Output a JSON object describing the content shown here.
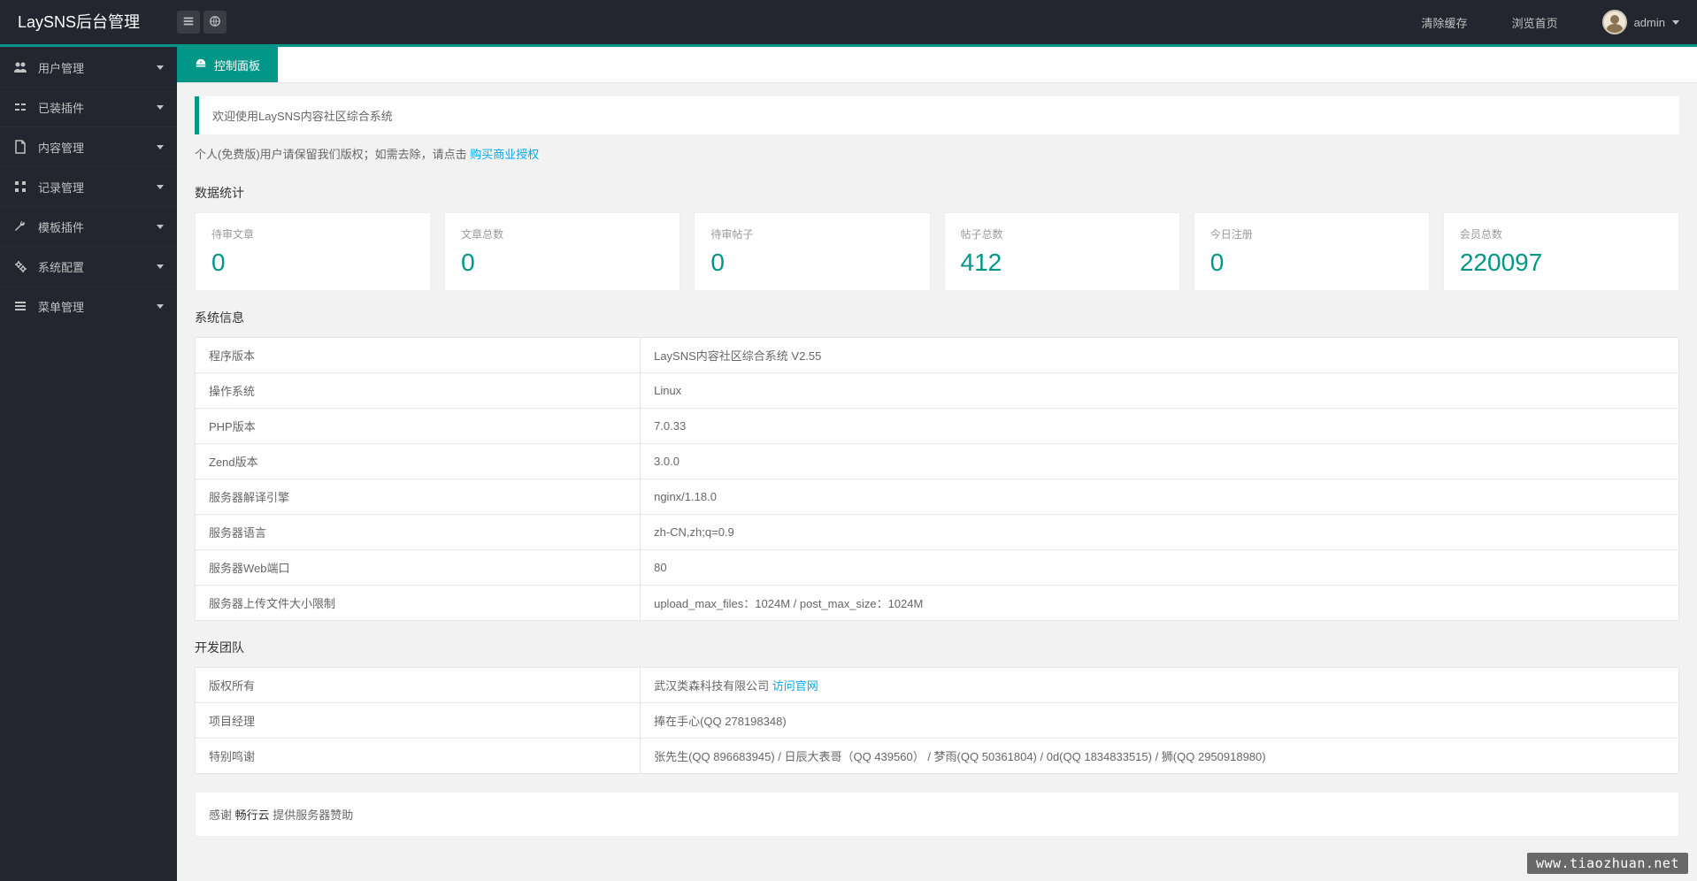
{
  "header": {
    "logo": "LaySNS后台管理",
    "clear_cache": "清除缓存",
    "browse_home": "浏览首页",
    "user_name": "admin"
  },
  "sidebar": {
    "items": [
      {
        "label": "用户管理",
        "icon": "users"
      },
      {
        "label": "已装插件",
        "icon": "plugin"
      },
      {
        "label": "内容管理",
        "icon": "file"
      },
      {
        "label": "记录管理",
        "icon": "grid"
      },
      {
        "label": "模板插件",
        "icon": "wrench"
      },
      {
        "label": "系统配置",
        "icon": "cogs"
      },
      {
        "label": "菜单管理",
        "icon": "menu"
      }
    ]
  },
  "tabs": {
    "dashboard": "控制面板"
  },
  "welcome": {
    "text": "欢迎使用LaySNS内容社区综合系统",
    "license_prefix": "个人(免费版)用户请保留我们版权；如需去除，请点击 ",
    "license_link": "购买商业授权"
  },
  "sections": {
    "stats_title": "数据统计",
    "sysinfo_title": "系统信息",
    "team_title": "开发团队"
  },
  "stats": [
    {
      "label": "待审文章",
      "value": "0"
    },
    {
      "label": "文章总数",
      "value": "0"
    },
    {
      "label": "待审帖子",
      "value": "0"
    },
    {
      "label": "帖子总数",
      "value": "412"
    },
    {
      "label": "今日注册",
      "value": "0"
    },
    {
      "label": "会员总数",
      "value": "220097"
    }
  ],
  "sysinfo": [
    {
      "label": "程序版本",
      "value": "LaySNS内容社区综合系统 V2.55"
    },
    {
      "label": "操作系统",
      "value": "Linux"
    },
    {
      "label": "PHP版本",
      "value": "7.0.33"
    },
    {
      "label": "Zend版本",
      "value": "3.0.0"
    },
    {
      "label": "服务器解译引擎",
      "value": "nginx/1.18.0"
    },
    {
      "label": "服务器语言",
      "value": "zh-CN,zh;q=0.9"
    },
    {
      "label": "服务器Web端口",
      "value": "80"
    },
    {
      "label": "服务器上传文件大小限制",
      "value": "upload_max_files：1024M / post_max_size：1024M"
    }
  ],
  "team": [
    {
      "label": "版权所有",
      "value": "武汉类森科技有限公司 ",
      "link": "访问官网"
    },
    {
      "label": "项目经理",
      "value": "捧在手心(QQ 278198348)"
    },
    {
      "label": "特别鸣谢",
      "value": "张先生(QQ 896683945) / 日辰大表哥（QQ 439560） / 梦雨(QQ 50361804) / 0d(QQ 1834833515) / 狮(QQ 2950918980)"
    }
  ],
  "sponsor": {
    "prefix": "感谢 ",
    "name": "畅行云",
    "suffix": " 提供服务器赞助"
  },
  "watermark": "www.tiaozhuan.net"
}
